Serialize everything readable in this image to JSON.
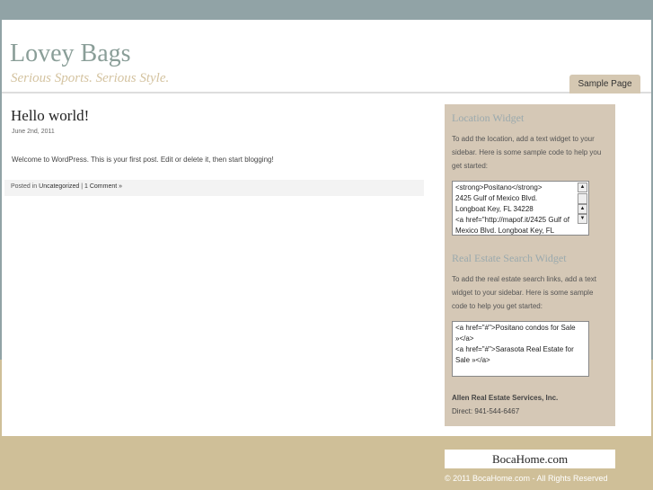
{
  "header": {
    "title": "Lovey Bags",
    "tagline": "Serious Sports. Serious Style.",
    "nav": [
      {
        "label": "Sample Page"
      }
    ]
  },
  "post": {
    "title": "Hello world!",
    "date": "June 2nd, 2011",
    "body": "Welcome to WordPress. This is your first post. Edit or delete it, then start blogging!",
    "posted_in": "Posted in",
    "category": "Uncategorized",
    "separator": " | ",
    "comments": "1 Comment »"
  },
  "sidebar": {
    "location": {
      "title": "Location Widget",
      "text": "To add the location, add a text widget to your sidebar. Here is some sample code to help you get started:",
      "code": [
        "<strong>Positano</strong>",
        "2425 Gulf of Mexico Blvd.",
        "Longboat Key, FL 34228",
        "<a href=\"http://mapof.it/2425 Gulf of",
        "Mexico Blvd. Longboat Key, FL"
      ]
    },
    "realestate": {
      "title": "Real Estate Search Widget",
      "text": "To add the real estate search links, add a text widget to your sidebar. Here is some sample code to help you get started:",
      "code": [
        "<a href=\"#\">Positano condos for Sale",
        "»</a>",
        "<a href=\"#\">Sarasota Real Estate for",
        "Sale »</a>"
      ]
    },
    "contact": {
      "company": "Allen Real Estate Services, Inc.",
      "phone": "Direct: 941-544-6467"
    }
  },
  "footer": {
    "logo": "BocaHome.com",
    "copyright": "© 2011 BocaHome.com - All Rights Reserved"
  }
}
